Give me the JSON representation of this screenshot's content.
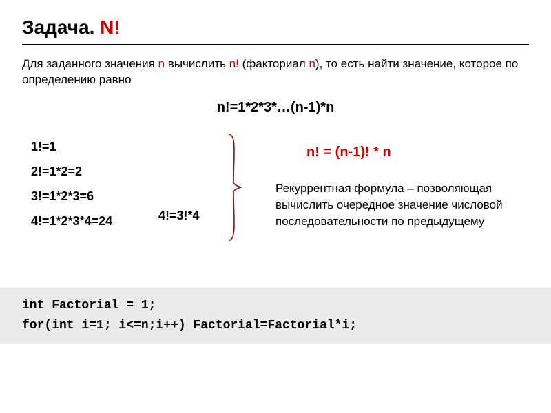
{
  "title_part1": "Задача. ",
  "title_part2": "N!",
  "description_pre": "Для заданного значения ",
  "description_n": "n",
  "description_mid": " вычислить ",
  "description_nfact": "n!",
  "description_aft": " (факториал ",
  "description_n2": "n",
  "description_end": "), то есть найти значение, которое по определению равно",
  "formula_main": "n!=1*2*3*…(n-1)*n",
  "examples": {
    "e1": "1!=1",
    "e2": "2!=1*2=2",
    "e3": "3!=1*2*3=6",
    "e4": "4!=1*2*3*4=24",
    "e4b": "4!=3!*4"
  },
  "rec_formula": "n! = (n-1)! * n",
  "rec_text": "Рекуррентная формула – позволяющая вычислить очередное значение числовой последовательности по предыдущему",
  "code_line1": "int Factorial = 1;",
  "code_line2": "for(int i=1; i<=n;i++) Factorial=Factorial*i;"
}
